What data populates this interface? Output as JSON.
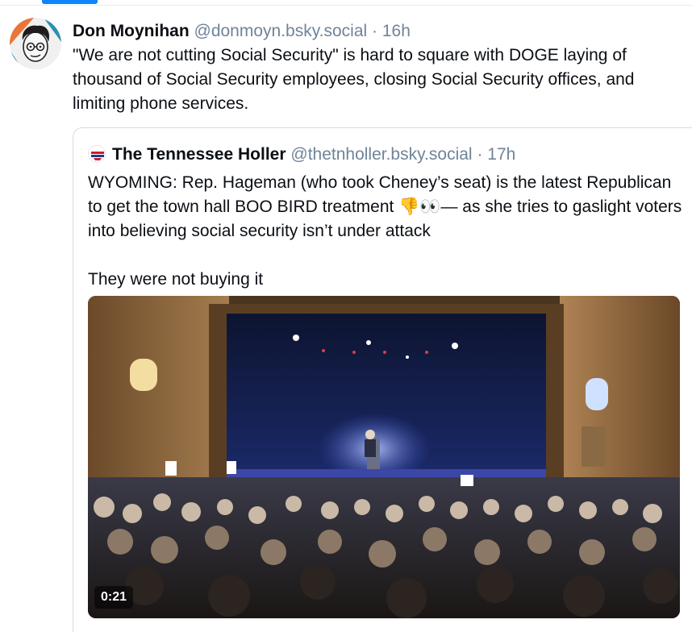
{
  "post": {
    "author_name": "Don Moynihan",
    "author_handle": "@donmoyn.bsky.social",
    "separator": "·",
    "time": "16h",
    "text": "\"We are not cutting Social Security\" is hard to square with DOGE laying of thousand of Social Security employees, closing Social Security offices, and limiting phone services."
  },
  "quote": {
    "author_name": "The Tennessee Holler",
    "author_handle": "@thetnholler.bsky.social",
    "separator": "·",
    "time": "17h",
    "text": "WYOMING: Rep. Hageman (who took Cheney’s seat) is the latest Republican to get the town hall BOO BIRD treatment 👎👀— as she tries to gaslight voters into believing social security isn’t under attack\n\nThey were not buying it",
    "video": {
      "duration": "0:21"
    }
  },
  "colors": {
    "accent": "#1083fe",
    "muted_text": "#6f8499",
    "border": "#d4dbe2"
  }
}
